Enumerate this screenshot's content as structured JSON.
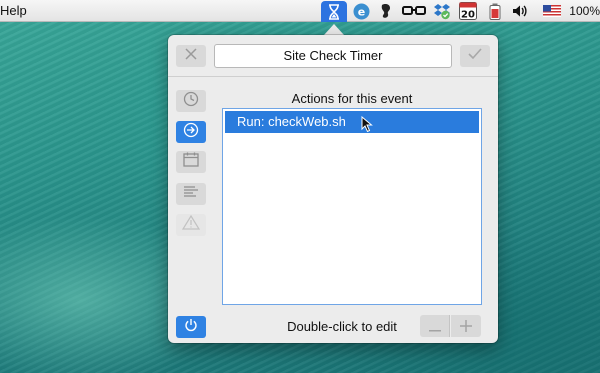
{
  "menubar": {
    "help_label": "Help",
    "calendar_day": "20",
    "battery_percent": "100%",
    "icons": [
      "hourglass-icon",
      "sync-icon",
      "evernote-icon",
      "glasses-icon",
      "dropbox-icon",
      "calendar-icon",
      "battery-utility-icon",
      "volume-icon",
      "flag-icon"
    ]
  },
  "popover": {
    "title": "Site Check Timer",
    "section_label": "Actions for this event",
    "actions": [
      {
        "label": "Run: checkWeb.sh",
        "selected": true
      }
    ],
    "footer_hint": "Double-click to edit",
    "sidebar": [
      "clock-icon",
      "arrow-circle-icon",
      "calendar-icon",
      "text-lines-icon",
      "warning-icon"
    ],
    "active_tab": "arrow-circle-icon"
  },
  "colors": {
    "accent": "#2f82e3",
    "selection": "#2a7cdd"
  }
}
